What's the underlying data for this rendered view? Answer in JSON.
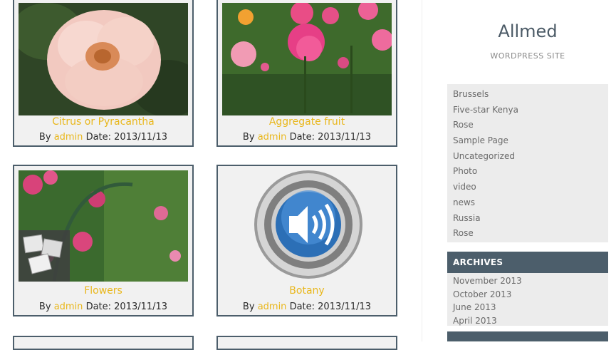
{
  "posts": [
    {
      "title": "Citrus or Pyracantha",
      "by": "By",
      "author": "admin",
      "date": "Date: 2013/11/13"
    },
    {
      "title": "Aggregate fruit",
      "by": "By",
      "author": "admin",
      "date": "Date: 2013/11/13"
    },
    {
      "title": "Flowers",
      "by": "By",
      "author": "admin",
      "date": "Date: 2013/11/13"
    },
    {
      "title": "Botany",
      "by": "By",
      "author": "admin",
      "date": "Date: 2013/11/13"
    }
  ],
  "site": {
    "title": "Allmed",
    "tagline": "WORDPRESS SITE"
  },
  "categories": [
    "Brussels",
    "Five-star Kenya",
    "Rose",
    "Sample Page",
    "Uncategorized",
    "Photo",
    "video",
    "news",
    "Russia",
    "Rose"
  ],
  "archives": {
    "heading": "ARCHIVES",
    "items": [
      "November 2013",
      "October 2013",
      "June 2013",
      "April 2013"
    ]
  },
  "colors": {
    "accent": "#e9b71c",
    "widget_header": "#4c5e6b",
    "card_border": "#4c5e6b",
    "card_bg": "#f1f1f1"
  }
}
